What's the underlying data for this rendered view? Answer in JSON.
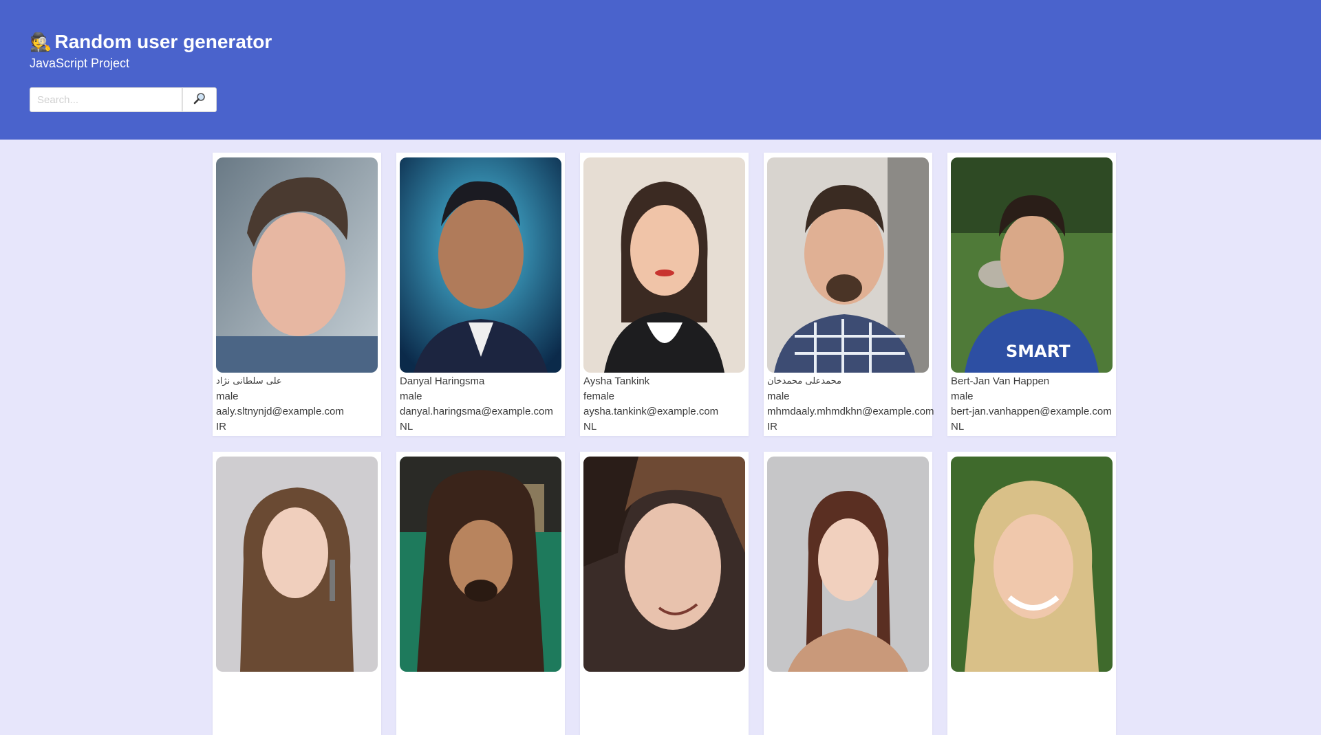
{
  "header": {
    "icon": "spy-icon",
    "title": "Random user generator",
    "subtitle": "JavaScript Project",
    "search_placeholder": "Search...",
    "search_button_icon": "magnifier-icon"
  },
  "colors": {
    "header_bg": "#4a63cc",
    "page_bg": "#e7e6fb",
    "card_bg": "#ffffff"
  },
  "users": [
    {
      "name": "علی سلطانی نژاد",
      "gender": "male",
      "email": "aaly.sltnynjd@example.com",
      "nat": "IR"
    },
    {
      "name": "Danyal Haringsma",
      "gender": "male",
      "email": "danyal.haringsma@example.com",
      "nat": "NL"
    },
    {
      "name": "Aysha Tankink",
      "gender": "female",
      "email": "aysha.tankink@example.com",
      "nat": "NL"
    },
    {
      "name": "محمدعلی محمدخان",
      "gender": "male",
      "email": "mhmdaaly.mhmdkhn@example.com",
      "nat": "IR"
    },
    {
      "name": "Bert-Jan Van Happen",
      "gender": "male",
      "email": "bert-jan.vanhappen@example.com",
      "nat": "NL"
    }
  ]
}
